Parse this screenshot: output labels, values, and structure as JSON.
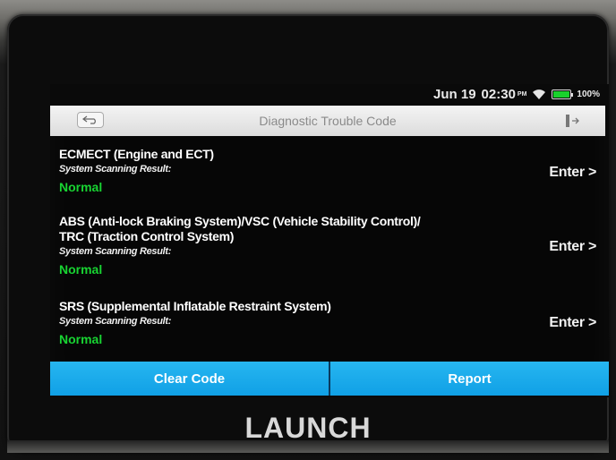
{
  "status_bar": {
    "date": "Jun 19",
    "time": "02:30",
    "ampm": "PM",
    "battery": "100%"
  },
  "header": {
    "title": "Diagnostic Trouble Code"
  },
  "systems": [
    {
      "name_lines": [
        "ECMECT (Engine and ECT)"
      ],
      "scan_label": "System Scanning Result:",
      "status": "Normal",
      "enter_label": "Enter >"
    },
    {
      "name_lines": [
        "ABS (Anti-lock Braking System)/VSC (Vehicle Stability Control)/",
        "TRC (Traction Control System)"
      ],
      "scan_label": "System Scanning Result:",
      "status": "Normal",
      "enter_label": "Enter >"
    },
    {
      "name_lines": [
        "SRS (Supplemental Inflatable Restraint System)"
      ],
      "scan_label": "System Scanning Result:",
      "status": "Normal",
      "enter_label": "Enter >"
    }
  ],
  "footer": {
    "clear_code_label": "Clear Code",
    "report_label": "Report"
  },
  "device": {
    "brand": "LAUNCH"
  },
  "colors": {
    "accent": "#1aa9ec",
    "status_ok": "#18d432",
    "battery": "#19d12c"
  }
}
